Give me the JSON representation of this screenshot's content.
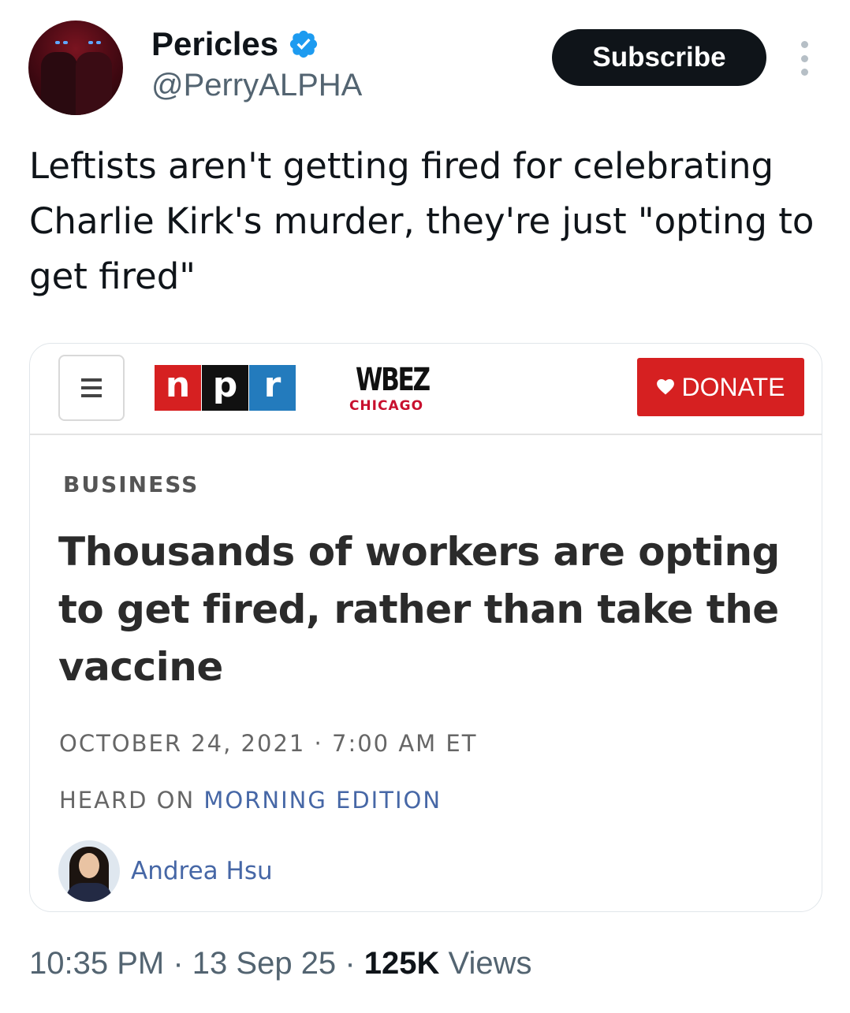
{
  "tweet": {
    "author": {
      "display_name": "Pericles",
      "handle": "@PerryALPHA",
      "verified": true,
      "avatar_icon": "profile-avatar"
    },
    "subscribe_label": "Subscribe",
    "more_icon": "more-vertical-icon",
    "text": "Leftists aren't getting fired for celebrating Charlie Kirk's murder, they're just \"opting to get fired\"",
    "time": "10:35 PM",
    "separator": "·",
    "date": "13 Sep 25",
    "views_count": "125K",
    "views_label": "Views"
  },
  "card": {
    "menu_icon": "hamburger-menu-icon",
    "npr_logo": [
      "n",
      "p",
      "r"
    ],
    "station_name": "WBEZ",
    "station_city": "CHICAGO",
    "donate_label": "DONATE",
    "section": "BUSINESS",
    "headline": "Thousands of workers are opting to get fired, rather than take the vaccine",
    "dateline": "OCTOBER 24, 2021 · 7:00 AM ET",
    "heard_on_prefix": "HEARD ON ",
    "program": "MORNING EDITION",
    "author_name": "Andrea Hsu"
  },
  "colors": {
    "verified_blue": "#1d9bf0",
    "npr_red": "#d62021",
    "npr_blue": "#237bbd",
    "link_blue": "#4667a6",
    "text_gray": "#536471"
  }
}
